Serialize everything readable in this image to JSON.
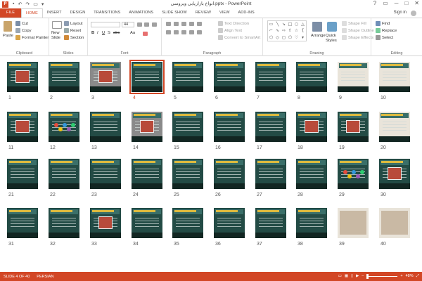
{
  "titlebar": {
    "title": "انواع بازاریابی ویروسی.pptx - PowerPoint",
    "qat_icons": [
      "save-icon",
      "undo-icon",
      "redo-icon",
      "start-from-beginning-icon",
      "customize-qat-icon"
    ],
    "controls": [
      "?",
      "▭",
      "─",
      "□",
      "✕"
    ]
  },
  "tabs": [
    "FILE",
    "HOME",
    "INSERT",
    "DESIGN",
    "TRANSITIONS",
    "ANIMATIONS",
    "SLIDE SHOW",
    "REVIEW",
    "VIEW",
    "ADD-INS"
  ],
  "active_tab": "HOME",
  "signin": "Sign in",
  "ribbon": {
    "clipboard": {
      "label": "Clipboard",
      "paste": "Paste",
      "cut": "Cut",
      "copy": "Copy",
      "format_painter": "Format Painter"
    },
    "slides": {
      "label": "Slides",
      "new_slide": "New Slide",
      "layout": "Layout",
      "reset": "Reset",
      "section": "Section"
    },
    "font": {
      "label": "Font",
      "size": "44",
      "bold": "B",
      "italic": "I",
      "underline": "U",
      "shadow": "S",
      "strike": "abc",
      "aa": "Aa"
    },
    "paragraph": {
      "label": "Paragraph",
      "text_direction": "Text Direction",
      "align_text": "Align Text",
      "convert_smartart": "Convert to SmartArt"
    },
    "drawing": {
      "label": "Drawing",
      "arrange": "Arrange",
      "quick_styles": "Quick Styles",
      "shape_fill": "Shape Fill",
      "shape_outline": "Shape Outline",
      "shape_effects": "Shape Effects"
    },
    "editing": {
      "label": "Editing",
      "find": "Find",
      "replace": "Replace",
      "select": "Select"
    }
  },
  "slides": [
    "1",
    "2",
    "3",
    "4",
    "5",
    "6",
    "7",
    "8",
    "9",
    "10",
    "11",
    "12",
    "13",
    "14",
    "15",
    "16",
    "17",
    "18",
    "19",
    "20",
    "21",
    "22",
    "23",
    "24",
    "25",
    "26",
    "27",
    "28",
    "29",
    "30",
    "31",
    "32",
    "33",
    "34",
    "35",
    "36",
    "37",
    "38",
    "39",
    "40"
  ],
  "selected_slide": "4",
  "status": {
    "slide_info": "SLIDE 4 OF 40",
    "language": "PERSIAN",
    "zoom": "48%",
    "minus": "–",
    "plus": "+"
  },
  "colors": {
    "accent": "#d24726",
    "slide_bg": "#234b45"
  }
}
